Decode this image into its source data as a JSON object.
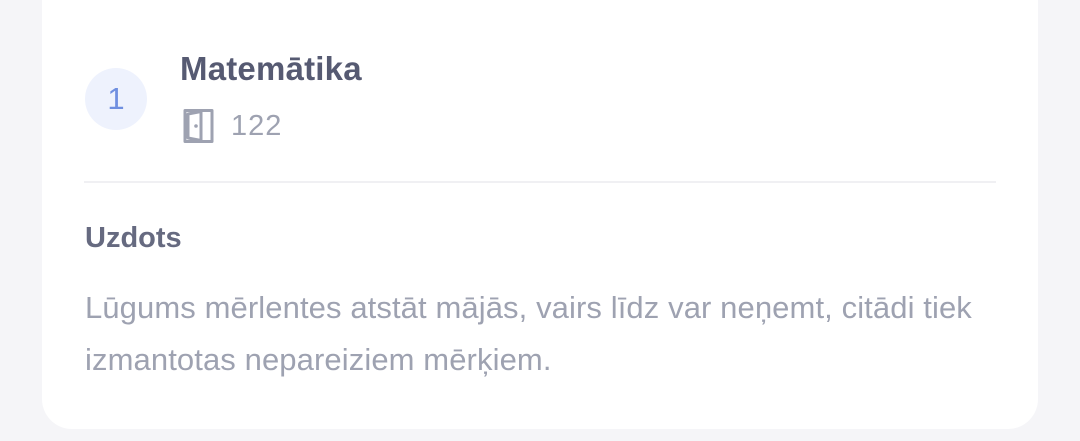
{
  "lesson": {
    "number": "1",
    "subject": "Matemātika",
    "room_icon": "door-icon",
    "room": "122"
  },
  "homework": {
    "label": "Uzdots",
    "text": "Lūgums mērlentes atstāt mājās, vairs līdz var neņemt, citādi tiek izmantotas nepareiziem mērķiem."
  },
  "colors": {
    "page_background": "#f5f5f8",
    "card_background": "#ffffff",
    "number_badge_background": "#eef2fd",
    "number_color": "#6f8fe0",
    "title_color": "#565a72",
    "muted_text": "#9ea2b1"
  }
}
